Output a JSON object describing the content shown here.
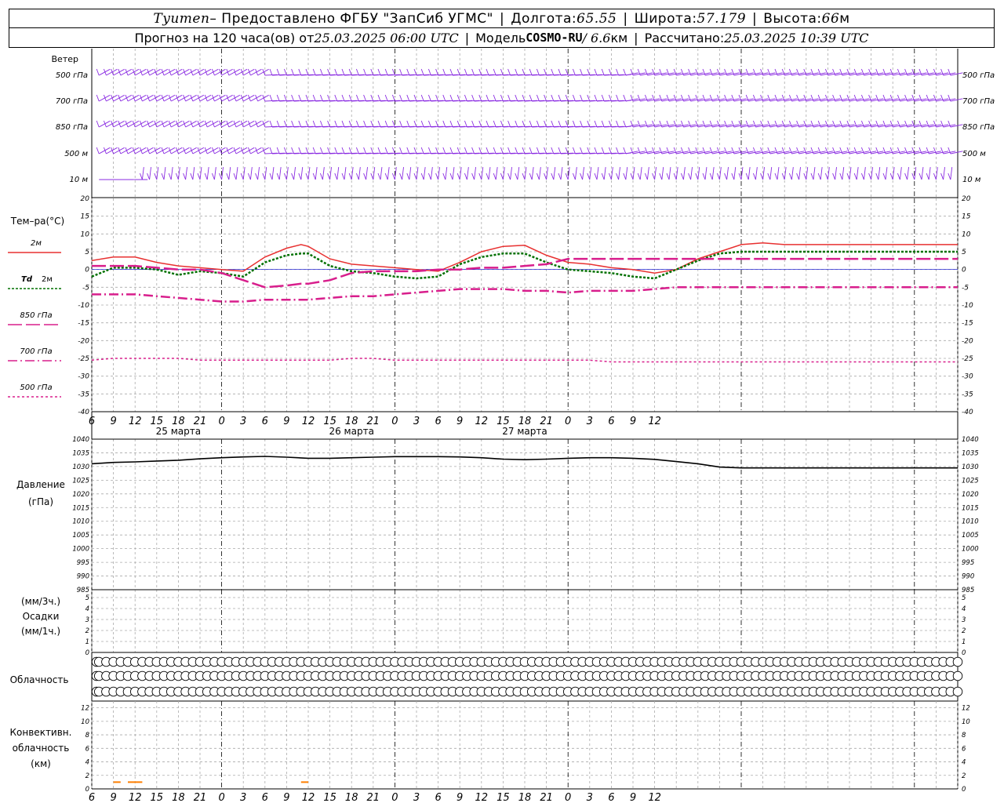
{
  "header": {
    "station": "Tyumen",
    "provider": " – Предоставлено ФГБУ \"ЗапСиб УГМС\"",
    "lon_label": "Долгота: ",
    "lon_value": "65.55",
    "lat_label": "Широта: ",
    "lat_value": "57.179",
    "alt_label": "Высота: ",
    "alt_value": "66",
    "alt_unit": "м",
    "forecast_label": "Прогноз на 120 часа(ов) от ",
    "forecast_time": "25.03.2025 06:00 UTC",
    "model_label": "Модель ",
    "model_name": "COSMO-RU",
    "model_res": " / 6.6",
    "model_res_unit": "км",
    "calc_label": "Рассчитано: ",
    "calc_time": "25.03.2025 10:39 UTC"
  },
  "time_axis": {
    "hour_labels": [
      "6",
      "9",
      "12",
      "15",
      "18",
      "21",
      "0",
      "3",
      "6",
      "9",
      "12",
      "15",
      "18",
      "21",
      "0",
      "3",
      "6",
      "9",
      "12",
      "15",
      "18",
      "21",
      "0",
      "3",
      "6",
      "9",
      "12"
    ],
    "date_labels": [
      "25 марта",
      "26 марта",
      "27 марта"
    ]
  },
  "wind_panel": {
    "title": "Ветер",
    "levels": [
      "500 гПа",
      "700 гПа",
      "850 гПа",
      "500 м",
      "10 м"
    ]
  },
  "temp_panel": {
    "title": "Тем–ра(°C)",
    "ticks": [
      "20",
      "15",
      "10",
      "5",
      "0",
      "-5",
      "-10",
      "-15",
      "-20",
      "-25",
      "-30",
      "-35",
      "-40"
    ],
    "legend": [
      {
        "label": "2м",
        "color": "#e83030"
      },
      {
        "label": "Td",
        "label2": "2м",
        "color": "#007000"
      },
      {
        "label": "850 гПа",
        "color": "#d81e8c"
      },
      {
        "label": "700 гПа",
        "color": "#d81e8c"
      },
      {
        "label": "500 гПа",
        "color": "#d81e8c"
      }
    ]
  },
  "pressure_panel": {
    "title": "Давление",
    "unit": "(гПа)",
    "ticks": [
      "1040",
      "1035",
      "1030",
      "1025",
      "1020",
      "1015",
      "1010",
      "1005",
      "1000",
      "995",
      "990",
      "985"
    ]
  },
  "precip_panel": {
    "unit1": "(мм/3ч.)",
    "title": "Осадки",
    "unit2": "(мм/1ч.)",
    "ticks": [
      "5",
      "4",
      "3",
      "2",
      "1",
      "0"
    ]
  },
  "cloud_panel": {
    "title": "Облачность"
  },
  "conv_panel": {
    "title1": "Конвективн.",
    "title2": "облачность",
    "unit": "(км)",
    "ticks": [
      "12",
      "10",
      "8",
      "6",
      "4",
      "2",
      "0"
    ]
  },
  "colors": {
    "wind": "#8a2be2",
    "t2m": "#e83030",
    "td2m": "#007000",
    "upper": "#d81e8c",
    "pressure": "#000000",
    "conv": "#ff7f00",
    "zero_line": "#0000cc"
  },
  "chart_data": [
    {
      "type": "line",
      "title": "Тем–ра(°C)",
      "x": [
        6,
        9,
        12,
        15,
        18,
        21,
        24,
        27,
        30,
        33,
        35,
        36,
        39,
        42,
        45,
        48,
        51,
        54,
        57,
        60,
        63,
        66,
        69,
        72,
        75,
        78,
        81,
        84,
        87,
        90,
        93,
        96,
        99,
        102,
        105,
        108,
        111,
        114,
        117,
        120,
        123,
        126
      ],
      "ylim": [
        -40,
        20
      ],
      "series": [
        {
          "name": "2м",
          "values": [
            2.5,
            3.5,
            3.5,
            2.0,
            1.0,
            0.5,
            0.0,
            -0.5,
            3.5,
            6.0,
            7.0,
            6.5,
            3.0,
            1.5,
            1.0,
            0.5,
            0.0,
            -0.5,
            2.0,
            5.0,
            6.5,
            6.8,
            4.0,
            2.0,
            1.5,
            0.5,
            0.0,
            -1.0,
            0.0,
            3.0,
            5.0,
            7.0,
            7.5,
            7.0,
            7.0,
            7.0,
            7.0,
            7.0,
            7.0,
            7.0,
            7.0,
            7.0
          ]
        },
        {
          "name": "Td 2м",
          "values": [
            -2.0,
            0.5,
            0.5,
            0.0,
            -1.5,
            -0.5,
            -1.0,
            -2.0,
            2.0,
            4.0,
            4.5,
            4.5,
            1.0,
            -0.5,
            -1.0,
            -2.0,
            -2.5,
            -2.0,
            1.5,
            3.5,
            4.5,
            4.5,
            2.0,
            0.0,
            -0.5,
            -1.0,
            -2.0,
            -2.5,
            0.0,
            2.5,
            4.5,
            5.0,
            5.0,
            5.0,
            5.0,
            5.0,
            5.0,
            5.0,
            5.0,
            5.0,
            5.0,
            5.0
          ]
        },
        {
          "name": "850 гПа",
          "values": [
            1.0,
            1.0,
            1.0,
            0.5,
            0.0,
            0.0,
            -1.0,
            -3.0,
            -5.0,
            -4.5,
            -4.0,
            -4.0,
            -3.0,
            -1.0,
            -0.5,
            -0.5,
            -0.5,
            0.0,
            0.0,
            0.5,
            0.5,
            1.0,
            1.5,
            3.0,
            3.0,
            3.0,
            3.0,
            3.0,
            3.0,
            3.0,
            3.0,
            3.0,
            3.0,
            3.0,
            3.0,
            3.0,
            3.0,
            3.0,
            3.0,
            3.0,
            3.0,
            3.0
          ]
        },
        {
          "name": "700 гПа",
          "values": [
            -7,
            -7,
            -7,
            -7.5,
            -8,
            -8.5,
            -9,
            -9,
            -8.5,
            -8.5,
            -8.5,
            -8.5,
            -8,
            -7.5,
            -7.5,
            -7,
            -6.5,
            -6,
            -5.5,
            -5.5,
            -5.5,
            -6,
            -6,
            -6.5,
            -6,
            -6,
            -6,
            -5.5,
            -5,
            -5,
            -5,
            -5,
            -5,
            -5,
            -5,
            -5,
            -5,
            -5,
            -5,
            -5,
            -5,
            -5
          ]
        },
        {
          "name": "500 гПа",
          "values": [
            -25.5,
            -25,
            -25,
            -25,
            -25,
            -25.5,
            -25.5,
            -25.5,
            -25.5,
            -25.5,
            -25.5,
            -25.5,
            -25.5,
            -25,
            -25,
            -25.5,
            -25.5,
            -25.5,
            -25.5,
            -25.5,
            -25.5,
            -25.5,
            -25.5,
            -25.5,
            -25.5,
            -26,
            -26,
            -26,
            -26,
            -26,
            -26,
            -26,
            -26,
            -26,
            -26,
            -26,
            -26,
            -26,
            -26,
            -26,
            -26,
            -26
          ]
        }
      ]
    },
    {
      "type": "line",
      "title": "Давление",
      "x": [
        6,
        9,
        12,
        15,
        18,
        21,
        24,
        27,
        30,
        33,
        36,
        39,
        42,
        45,
        48,
        51,
        54,
        57,
        60,
        63,
        66,
        69,
        72,
        75,
        78,
        81,
        84,
        87,
        90,
        93,
        96,
        99,
        102,
        105,
        108,
        111,
        114,
        117,
        120,
        123,
        126
      ],
      "ylim": [
        985,
        1040
      ],
      "series": [
        {
          "name": "Давление",
          "values": [
            1031.0,
            1031.5,
            1031.7,
            1032.0,
            1032.3,
            1032.8,
            1033.2,
            1033.5,
            1033.7,
            1033.4,
            1033.0,
            1033.0,
            1033.2,
            1033.4,
            1033.6,
            1033.6,
            1033.6,
            1033.5,
            1033.2,
            1032.7,
            1032.5,
            1032.7,
            1033.0,
            1033.2,
            1033.2,
            1033.0,
            1032.6,
            1031.8,
            1031.0,
            1029.8,
            1029.5,
            1029.5,
            1029.5,
            1029.5,
            1029.5,
            1029.5,
            1029.5,
            1029.5,
            1029.5,
            1029.5,
            1029.5
          ]
        }
      ]
    },
    {
      "type": "table",
      "title": "Облачность",
      "rows": [
        "upper",
        "middle",
        "lower"
      ],
      "x_start": 6,
      "x_step": 1,
      "cover_octas": [
        [
          0,
          0,
          0,
          0,
          0,
          0,
          0,
          0,
          0,
          0,
          0,
          0,
          0,
          0,
          0,
          0,
          0,
          0,
          0,
          0,
          0,
          0,
          0,
          0,
          0,
          0,
          0,
          0,
          0,
          0,
          0,
          0,
          0,
          0,
          0,
          0,
          0,
          0,
          0,
          0,
          0,
          0,
          0,
          0,
          0,
          0,
          0,
          0,
          0,
          0,
          0,
          0,
          0,
          0,
          0,
          0,
          0,
          0,
          0,
          0,
          0,
          0,
          0,
          0,
          0,
          0,
          0,
          0,
          0,
          0,
          0,
          0,
          0,
          0,
          0,
          0,
          0,
          0,
          0,
          0,
          0,
          0,
          0,
          0,
          0,
          0,
          0,
          0,
          0,
          0,
          0,
          0,
          0,
          0,
          0,
          0,
          0,
          0,
          0,
          0,
          0,
          0,
          0,
          0,
          0,
          0,
          0,
          0,
          0,
          0,
          0,
          0,
          0,
          0,
          0,
          0,
          0,
          0,
          0,
          0,
          0
        ],
        [
          0,
          0,
          0,
          0,
          0,
          0,
          0,
          0,
          0,
          0,
          0,
          0,
          0,
          0,
          0,
          0,
          0,
          0,
          0,
          0,
          0,
          0,
          0,
          0,
          0,
          0,
          0,
          0,
          0,
          0,
          0,
          0,
          0,
          0,
          0,
          0,
          0,
          0,
          0,
          0,
          0,
          0,
          0,
          0,
          0,
          0,
          0,
          0,
          0,
          0,
          0,
          0,
          0,
          0,
          0,
          0,
          0,
          0,
          0,
          0,
          0,
          0,
          0,
          0,
          0,
          0,
          0,
          0,
          0,
          0,
          0,
          0,
          0,
          0,
          0,
          0,
          0,
          0,
          0,
          0,
          0,
          0,
          0,
          0,
          0,
          0,
          0,
          0,
          0,
          0,
          0,
          0,
          0,
          0,
          0,
          0,
          0,
          0,
          0,
          0,
          0,
          0,
          0,
          0,
          0,
          0,
          0,
          0,
          0,
          0,
          0,
          0,
          0,
          0,
          0,
          0,
          0,
          0,
          0,
          0,
          0
        ],
        [
          0,
          0,
          0,
          0,
          0,
          0,
          0,
          0,
          0,
          0,
          0,
          0,
          0,
          0,
          0,
          0,
          0,
          0,
          0,
          0,
          0,
          0,
          0,
          0,
          0,
          0,
          0,
          0,
          0,
          0,
          0,
          0,
          0,
          0,
          0,
          0,
          0,
          0,
          0,
          0,
          0,
          0,
          0,
          0,
          0,
          0,
          0,
          0,
          0,
          0,
          0,
          0,
          0,
          0,
          0,
          0,
          0,
          0,
          0,
          0,
          0,
          0,
          0,
          0,
          0,
          0,
          0,
          0,
          0,
          0,
          0,
          0,
          0,
          0,
          0,
          0,
          0,
          0,
          0,
          0,
          0,
          0,
          0,
          0,
          0,
          0,
          0,
          0,
          0,
          0,
          0,
          0,
          0,
          0,
          0,
          0,
          0,
          0,
          0,
          0,
          0,
          0,
          0,
          0,
          0,
          0,
          0,
          0,
          0,
          0,
          0,
          0,
          0,
          0,
          0,
          0,
          0,
          0,
          0,
          0,
          0
        ]
      ]
    },
    {
      "type": "bar",
      "title": "Конвективн. облачность",
      "ylim": [
        0,
        12
      ],
      "segments": [
        {
          "x0": 9,
          "x1": 10,
          "base": 0,
          "top": 1
        },
        {
          "x0": 11,
          "x1": 13,
          "base": 0,
          "top": 1
        },
        {
          "x0": 35,
          "x1": 36,
          "base": 0,
          "top": 1
        }
      ]
    }
  ]
}
